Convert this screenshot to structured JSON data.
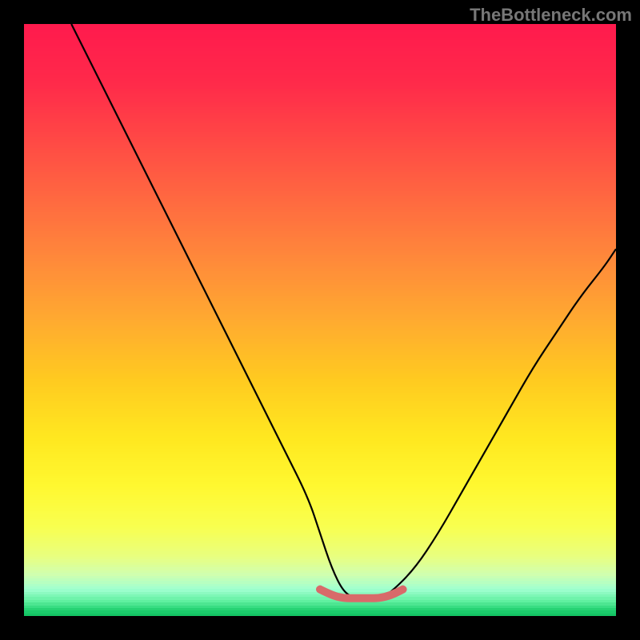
{
  "watermark": "TheBottleneck.com",
  "chart_data": {
    "type": "line",
    "title": "",
    "xlabel": "",
    "ylabel": "",
    "xlim": [
      0,
      100
    ],
    "ylim": [
      0,
      100
    ],
    "series": [
      {
        "name": "curve",
        "x": [
          8,
          12,
          16,
          20,
          24,
          28,
          32,
          36,
          40,
          44,
          48,
          50,
          52,
          54,
          56,
          58,
          60,
          62,
          66,
          70,
          74,
          78,
          82,
          86,
          90,
          94,
          98,
          100
        ],
        "y": [
          100,
          92,
          84,
          76,
          68,
          60,
          52,
          44,
          36,
          28,
          20,
          14,
          8,
          4,
          3,
          3,
          3,
          4,
          8,
          14,
          21,
          28,
          35,
          42,
          48,
          54,
          59,
          62
        ]
      },
      {
        "name": "bottom-marker",
        "x": [
          50,
          52,
          54,
          56,
          58,
          60,
          62,
          64
        ],
        "y": [
          4.5,
          3.5,
          3,
          3,
          3,
          3,
          3.5,
          4.5
        ]
      }
    ],
    "background_gradient": {
      "stops": [
        {
          "pos": 0.0,
          "color": "#ff1a4d"
        },
        {
          "pos": 0.1,
          "color": "#ff2a4a"
        },
        {
          "pos": 0.2,
          "color": "#ff4a45"
        },
        {
          "pos": 0.3,
          "color": "#ff6a40"
        },
        {
          "pos": 0.4,
          "color": "#ff8a3a"
        },
        {
          "pos": 0.5,
          "color": "#ffaa30"
        },
        {
          "pos": 0.6,
          "color": "#ffca20"
        },
        {
          "pos": 0.7,
          "color": "#ffe820"
        },
        {
          "pos": 0.78,
          "color": "#fff830"
        },
        {
          "pos": 0.85,
          "color": "#f8ff50"
        },
        {
          "pos": 0.9,
          "color": "#e8ff80"
        },
        {
          "pos": 0.93,
          "color": "#d0ffb0"
        },
        {
          "pos": 0.955,
          "color": "#a0ffd0"
        },
        {
          "pos": 0.975,
          "color": "#60f0a0"
        },
        {
          "pos": 0.99,
          "color": "#20d070"
        },
        {
          "pos": 1.0,
          "color": "#10c060"
        }
      ]
    },
    "marker_color": "#d86a6a"
  }
}
